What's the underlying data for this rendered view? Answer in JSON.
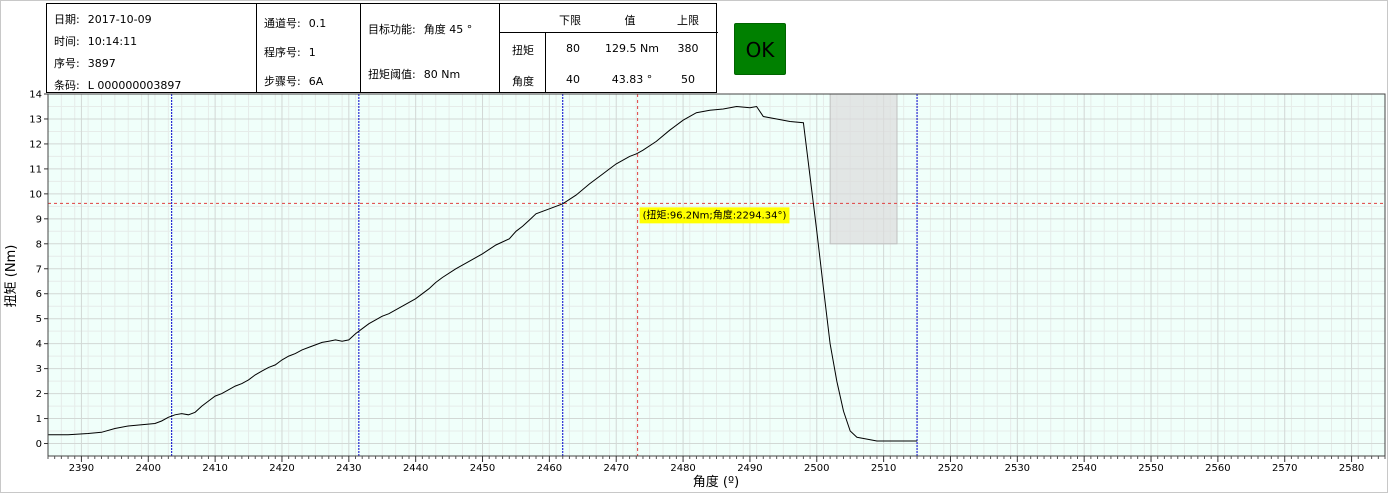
{
  "info": {
    "date_label": "日期:",
    "date_value": "2017-10-09",
    "time_label": "时间:",
    "time_value": "10:14:11",
    "seq_label": "序号:",
    "seq_value": "3897",
    "barcode_label": "条码:",
    "barcode_value": "L 000000003897",
    "channel_label": "通道号:",
    "channel_value": "0.1",
    "program_label": "程序号:",
    "program_value": "1",
    "step_label": "步骤号:",
    "step_value": "6A",
    "target_label": "目标功能:",
    "target_value": "角度  45 °",
    "threshold_label": "扭矩阈值:",
    "threshold_value": "80  Nm"
  },
  "limits": {
    "header_lower": "下限",
    "header_value": "值",
    "header_upper": "上限",
    "torque_label": "扭矩",
    "torque_lower": "80",
    "torque_value": "129.5 Nm",
    "torque_upper": "380",
    "angle_label": "角度",
    "angle_lower": "40",
    "angle_value": "43.83 °",
    "angle_upper": "50"
  },
  "status": {
    "ok_label": "OK",
    "ok_color": "#008000"
  },
  "chart_data": {
    "type": "line",
    "xlabel": "角度 (º)",
    "ylabel": "扭矩 (Nm)",
    "xlim": [
      2385,
      2585
    ],
    "ylim": [
      -0.5,
      14
    ],
    "xticks": [
      2390,
      2400,
      2410,
      2420,
      2430,
      2440,
      2450,
      2460,
      2470,
      2480,
      2490,
      2500,
      2510,
      2520,
      2530,
      2540,
      2550,
      2560,
      2570,
      2580
    ],
    "yticks": [
      0,
      1,
      2,
      3,
      4,
      5,
      6,
      7,
      8,
      9,
      10,
      11,
      12,
      13,
      14
    ],
    "grid": true,
    "background_color": "#f0fffa",
    "series": [
      {
        "color": "#000000",
        "x": [
          2385,
          2388,
          2391,
          2393,
          2395,
          2397,
          2399,
          2401,
          2402,
          2403,
          2404,
          2405,
          2406,
          2407,
          2408,
          2409,
          2410,
          2411,
          2412,
          2413,
          2414,
          2415,
          2416,
          2417,
          2418,
          2419,
          2420,
          2421,
          2422,
          2423,
          2424,
          2425,
          2426,
          2427,
          2428,
          2429,
          2430,
          2431,
          2432,
          2433,
          2434,
          2435,
          2436,
          2438,
          2440,
          2442,
          2443,
          2444,
          2446,
          2448,
          2450,
          2452,
          2454,
          2455,
          2456,
          2457,
          2458,
          2460,
          2462,
          2464,
          2466,
          2468,
          2469,
          2470,
          2471,
          2472,
          2473,
          2474,
          2476,
          2478,
          2480,
          2482,
          2484,
          2486,
          2488,
          2490,
          2491,
          2492,
          2494,
          2496,
          2498,
          2500,
          2501,
          2502,
          2503,
          2504,
          2505,
          2506,
          2507,
          2508,
          2509,
          2510,
          2511,
          2512,
          2513,
          2514,
          2515
        ],
        "y": [
          0.35,
          0.35,
          0.4,
          0.45,
          0.6,
          0.7,
          0.75,
          0.8,
          0.9,
          1.05,
          1.15,
          1.2,
          1.15,
          1.25,
          1.5,
          1.7,
          1.9,
          2.0,
          2.15,
          2.3,
          2.4,
          2.55,
          2.75,
          2.9,
          3.05,
          3.15,
          3.35,
          3.5,
          3.6,
          3.75,
          3.85,
          3.95,
          4.05,
          4.1,
          4.15,
          4.1,
          4.15,
          4.4,
          4.6,
          4.8,
          4.95,
          5.1,
          5.2,
          5.5,
          5.8,
          6.2,
          6.45,
          6.65,
          7.0,
          7.3,
          7.6,
          7.95,
          8.2,
          8.5,
          8.7,
          8.95,
          9.2,
          9.4,
          9.6,
          9.95,
          10.4,
          10.8,
          11.0,
          11.2,
          11.35,
          11.5,
          11.6,
          11.75,
          12.1,
          12.55,
          12.95,
          13.25,
          13.35,
          13.4,
          13.5,
          13.45,
          13.5,
          13.1,
          13.0,
          12.9,
          12.85,
          8.5,
          6.2,
          4.0,
          2.5,
          1.3,
          0.5,
          0.25,
          0.2,
          0.15,
          0.1,
          0.1,
          0.1,
          0.1,
          0.1,
          0.1,
          0.1
        ]
      }
    ],
    "markers": {
      "blue_vertical_x": [
        2403.5,
        2431.5,
        2462,
        2515
      ],
      "red_vertical_x": 2473.2,
      "red_horizontal_y": 9.62,
      "shaded_region": {
        "x": [
          2502,
          2512
        ],
        "y": [
          8,
          14
        ]
      }
    },
    "annotation": {
      "text": "(扭矩:96.2Nm;角度:2294.34°)",
      "x": 2473.2,
      "y": 9.62,
      "bg": "#ffff00"
    }
  }
}
